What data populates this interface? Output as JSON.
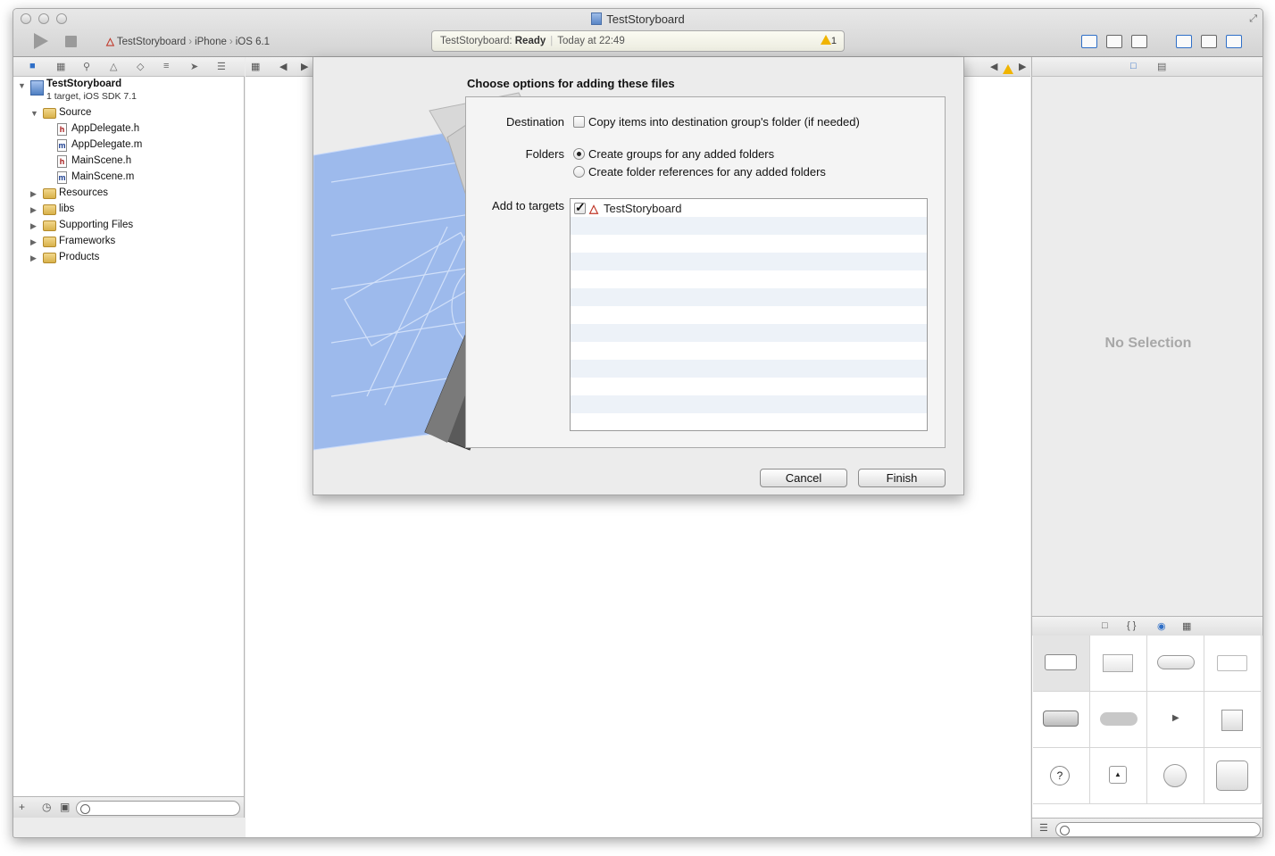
{
  "window": {
    "title": "TestStoryboard"
  },
  "toolbar": {
    "scheme": "TestStoryboard",
    "device": "iPhone",
    "sdk": "iOS 6.1",
    "activity_project": "TestStoryboard:",
    "activity_status": "Ready",
    "activity_time": "Today at 22:49",
    "warning_count": "1"
  },
  "navigator": {
    "project_name": "TestStoryboard",
    "project_subtitle": "1 target, iOS SDK 7.1",
    "items": [
      {
        "label": "Source",
        "kind": "folder",
        "expanded": true
      },
      {
        "label": "AppDelegate.h",
        "kind": "h"
      },
      {
        "label": "AppDelegate.m",
        "kind": "m"
      },
      {
        "label": "MainScene.h",
        "kind": "h"
      },
      {
        "label": "MainScene.m",
        "kind": "m"
      },
      {
        "label": "Resources",
        "kind": "folder"
      },
      {
        "label": "libs",
        "kind": "folder"
      },
      {
        "label": "Supporting Files",
        "kind": "folder"
      },
      {
        "label": "Frameworks",
        "kind": "folder"
      },
      {
        "label": "Products",
        "kind": "folder"
      }
    ]
  },
  "dialog": {
    "title": "Choose options for adding these files",
    "destination_label": "Destination",
    "destination_option": "Copy items into destination group's folder (if needed)",
    "destination_checked": false,
    "folders_label": "Folders",
    "folders_options": [
      {
        "label": "Create groups for any added folders",
        "selected": true
      },
      {
        "label": "Create folder references for any added folders",
        "selected": false
      }
    ],
    "targets_label": "Add to targets",
    "targets": [
      {
        "label": "TestStoryboard",
        "checked": true
      }
    ],
    "cancel_label": "Cancel",
    "finish_label": "Finish"
  },
  "inspector": {
    "empty_text": "No Selection"
  },
  "colors": {
    "accent": "#2f6fc7",
    "warning": "#f0b400"
  }
}
